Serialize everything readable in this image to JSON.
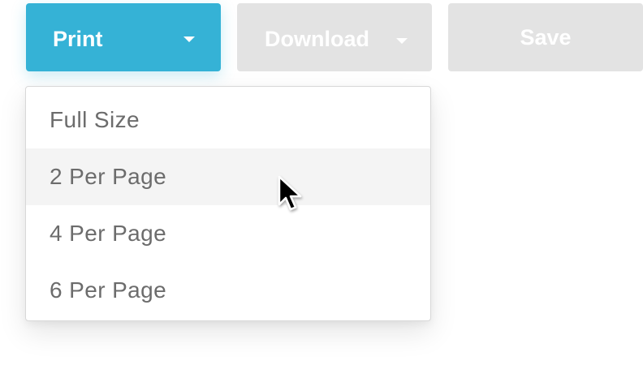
{
  "toolbar": {
    "print_label": "Print",
    "download_label": "Download",
    "save_label": "Save"
  },
  "print_menu": {
    "items": [
      {
        "label": "Full Size"
      },
      {
        "label": "2 Per Page"
      },
      {
        "label": "4 Per Page"
      },
      {
        "label": "6 Per Page"
      }
    ],
    "hovered_item": "2 Per Page"
  },
  "icons": {
    "print_caret": "chevron-down-icon",
    "download_caret": "chevron-down-icon",
    "pointer": "mouse-pointer-icon"
  },
  "colors": {
    "primary": "#35b2d6",
    "disabled": "#e3e3e3",
    "menu_text": "#6c6c6c",
    "menu_hover": "#f4f4f4"
  }
}
